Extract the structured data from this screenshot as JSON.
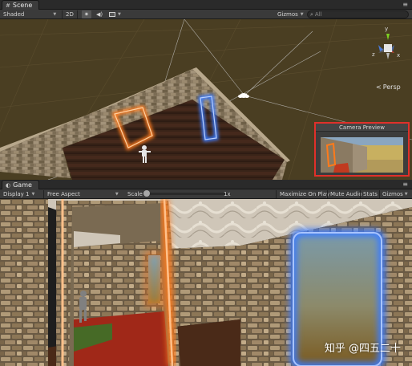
{
  "scene_tab": {
    "label": "Scene",
    "menu": "≡"
  },
  "scene_toolbar": {
    "shading_mode": "Shaded",
    "mode_2d": "2D",
    "lighting_icon": "sun-icon",
    "audio_icon": "speaker-icon",
    "effects_icon": "image-icon",
    "gizmos_label": "Gizmos",
    "search_placeholder": "All"
  },
  "scene_gizmo": {
    "projection": "Persp",
    "axes": {
      "x": "x",
      "y": "y",
      "z": "z"
    }
  },
  "camera_preview": {
    "title": "Camera Preview"
  },
  "game_tab": {
    "label": "Game",
    "menu": "≡"
  },
  "game_toolbar": {
    "display": "Display 1",
    "aspect": "Free Aspect",
    "scale_label": "Scale",
    "scale_value": "1x",
    "maximize": "Maximize On Play",
    "mute": "Mute Audio",
    "stats": "Stats",
    "gizmos": "Gizmos"
  },
  "watermark": "知乎 @四五二十",
  "colors": {
    "portal_orange": "#ff7a1a",
    "portal_blue": "#3a7bff",
    "highlight_red": "#e0302a",
    "scene_bg": "#4a3e22"
  }
}
